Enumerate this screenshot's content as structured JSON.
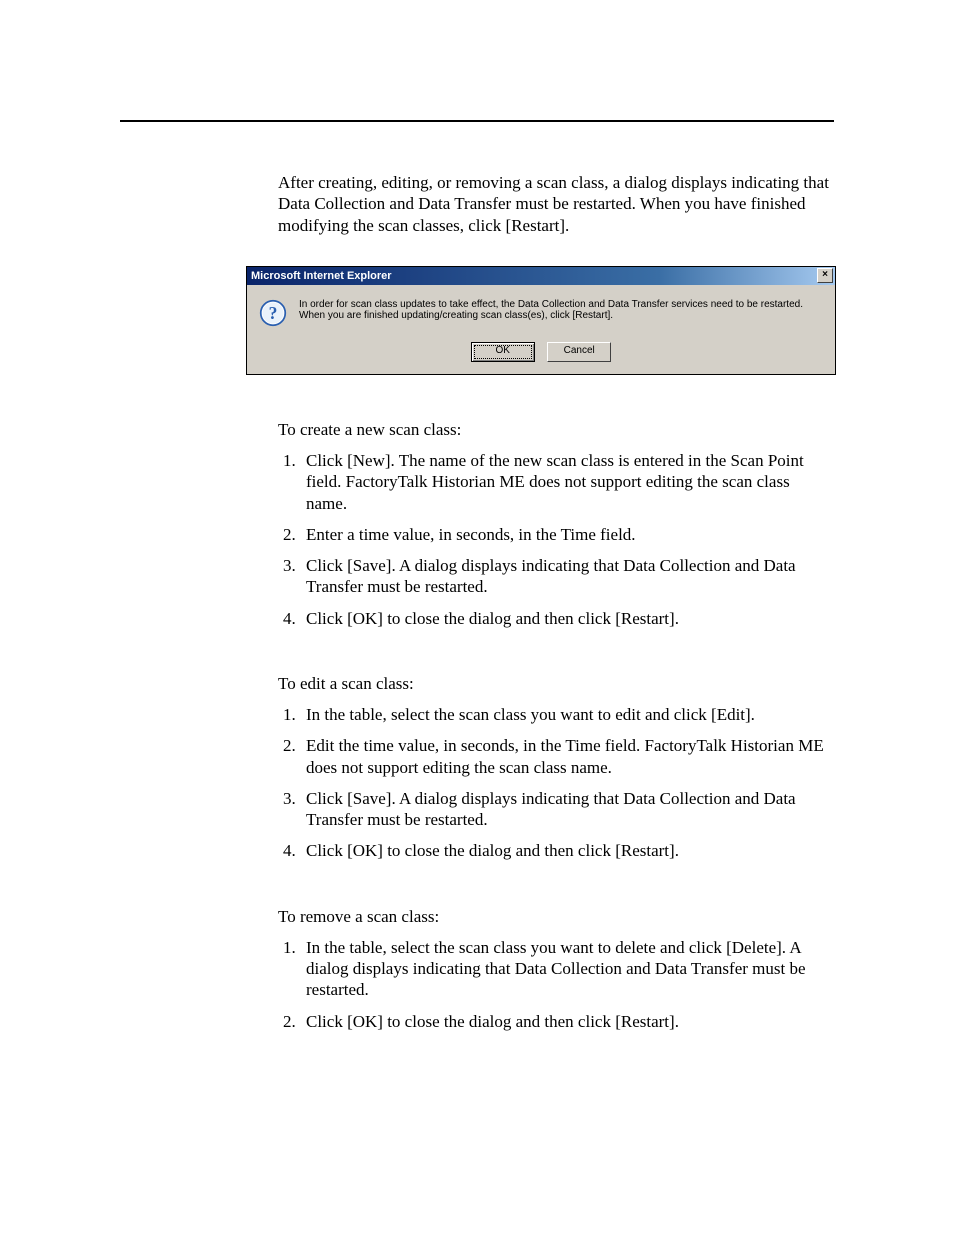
{
  "intro": "After creating, editing, or removing a scan class, a dialog displays indicating that Data Collection and Data Transfer must be restarted. When you have finished modifying the scan classes, click [Restart].",
  "dialog": {
    "title": "Microsoft Internet Explorer",
    "close": "×",
    "message": "In order for scan class updates to take effect, the Data Collection and Data Transfer services need to be restarted. When you are finished updating/creating scan class(es), click [Restart].",
    "ok": "OK",
    "cancel": "Cancel"
  },
  "create": {
    "lead": "To create a new scan class:",
    "steps": [
      "Click [New]. The name of the new scan class is entered in the Scan Point field. FactoryTalk Historian ME does not support editing the scan class name.",
      "Enter a time value, in seconds, in the Time field.",
      "Click [Save]. A dialog displays indicating that Data Collection and Data Transfer must be restarted.",
      "Click [OK] to close the dialog and then click [Restart]."
    ]
  },
  "edit": {
    "lead": "To edit a scan class:",
    "steps": [
      "In the table, select the scan class you want to edit and click [Edit].",
      "Edit the time value, in seconds, in the Time field. FactoryTalk Historian ME does not support editing the scan class name.",
      "Click [Save]. A dialog displays indicating that Data Collection and Data Transfer must be restarted.",
      "Click [OK] to close the dialog and then click [Restart]."
    ]
  },
  "remove": {
    "lead": "To remove a scan class:",
    "steps": [
      "In the table, select the scan class you want to delete and click [Delete]. A dialog displays indicating that Data Collection and Data Transfer must be restarted.",
      "Click [OK] to close the dialog and then click [Restart]."
    ]
  }
}
